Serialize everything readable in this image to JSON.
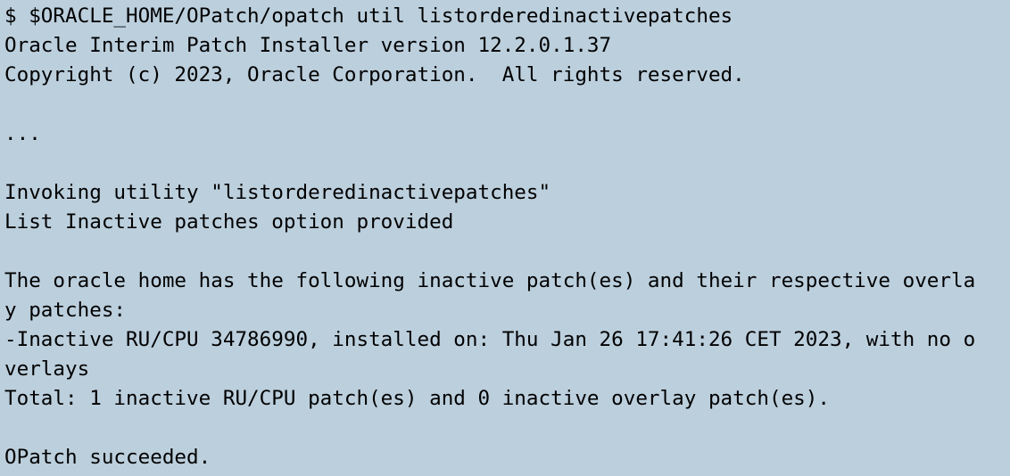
{
  "terminal": {
    "lines": [
      "$ $ORACLE_HOME/OPatch/opatch util listorderedinactivepatches",
      "Oracle Interim Patch Installer version 12.2.0.1.37",
      "Copyright (c) 2023, Oracle Corporation.  All rights reserved.",
      "",
      "...",
      "",
      "Invoking utility \"listorderedinactivepatches\"",
      "List Inactive patches option provided",
      "",
      "The oracle home has the following inactive patch(es) and their respective overla",
      "y patches:",
      "-Inactive RU/CPU 34786990, installed on: Thu Jan 26 17:41:26 CET 2023, with no o",
      "verlays",
      "Total: 1 inactive RU/CPU patch(es) and 0 inactive overlay patch(es).",
      "",
      "OPatch succeeded."
    ]
  },
  "colors": {
    "background": "#bccfdd",
    "text": "#000000"
  }
}
